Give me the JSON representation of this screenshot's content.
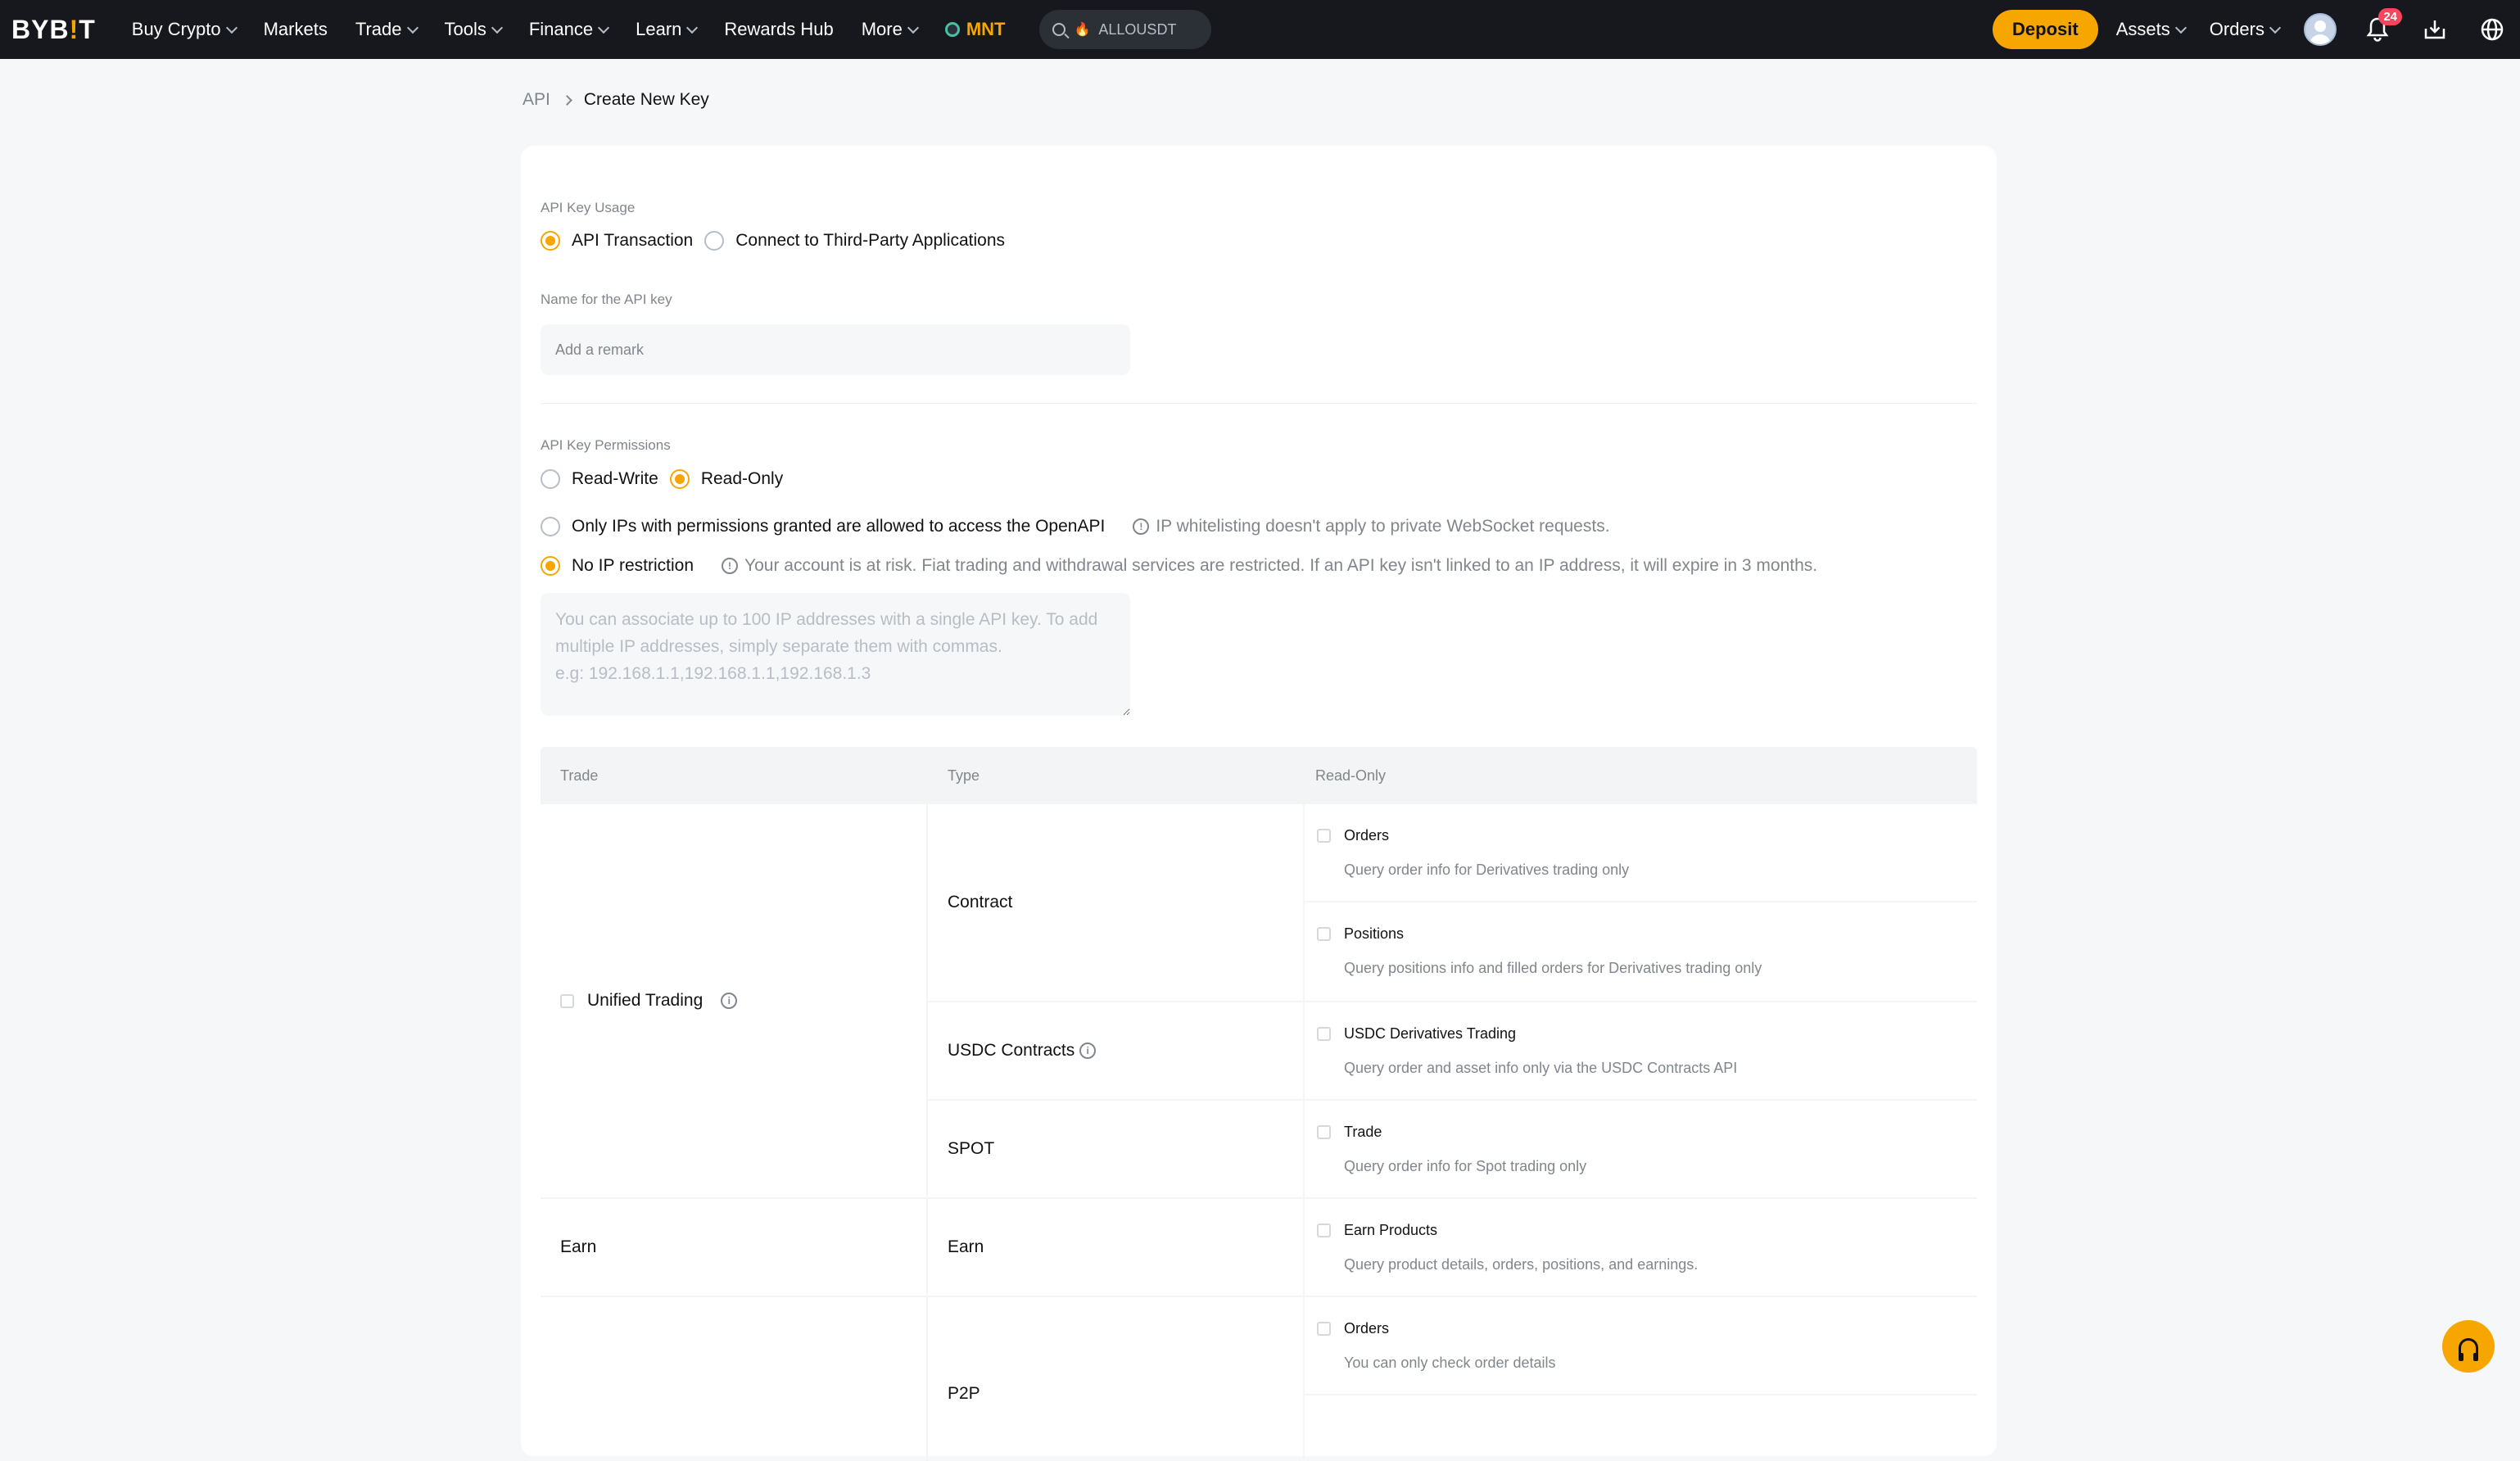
{
  "nav": {
    "logo": "BYBIT",
    "items": [
      {
        "label": "Buy Crypto",
        "dropdown": true
      },
      {
        "label": "Markets",
        "dropdown": false
      },
      {
        "label": "Trade",
        "dropdown": true
      },
      {
        "label": "Tools",
        "dropdown": true
      },
      {
        "label": "Finance",
        "dropdown": true
      },
      {
        "label": "Learn",
        "dropdown": true
      },
      {
        "label": "Rewards Hub",
        "dropdown": false
      },
      {
        "label": "More",
        "dropdown": true
      }
    ],
    "mnt": "MNT",
    "search_text": "ALLOUSDT",
    "deposit": "Deposit",
    "assets": "Assets",
    "orders": "Orders",
    "notification_count": "24",
    "colors": {
      "accent": "#f7a600",
      "nav_bg": "#17181e",
      "badge": "#f6465d"
    }
  },
  "breadcrumb": {
    "root": "API",
    "current": "Create New Key"
  },
  "form": {
    "usage_label": "API Key Usage",
    "usage_options": [
      {
        "label": "API Transaction",
        "selected": true
      },
      {
        "label": "Connect to Third-Party Applications",
        "selected": false
      }
    ],
    "name_label": "Name for the API key",
    "name_placeholder": "Add a remark",
    "permissions_label": "API Key Permissions",
    "permission_options": [
      {
        "label": "Read-Write",
        "selected": false
      },
      {
        "label": "Read-Only",
        "selected": true
      }
    ],
    "ip_option_restricted": "Only IPs with permissions granted are allowed to access the OpenAPI",
    "ip_note_restricted": "IP whitelisting doesn't apply to private WebSocket requests.",
    "ip_option_none": "No IP restriction",
    "ip_note_none": "Your account is at risk. Fiat trading and withdrawal services are restricted. If an API key isn't linked to an IP address, it will expire in 3 months.",
    "ip_placeholder": "You can associate up to 100 IP addresses with a single API key. To add multiple IP addresses, simply separate them with commas.\ne.g: 192.168.1.1,192.168.1.1,192.168.1.3"
  },
  "table": {
    "headers": {
      "trade": "Trade",
      "type": "Type",
      "perm": "Read-Only"
    },
    "trade_unified": "Unified Trading",
    "trade_earn": "Earn",
    "type_contract": "Contract",
    "type_usdc": "USDC Contracts",
    "type_spot": "SPOT",
    "type_earn": "Earn",
    "type_p2p": "P2P",
    "perms": [
      {
        "title": "Orders",
        "desc": "Query order info for Derivatives trading only"
      },
      {
        "title": "Positions",
        "desc": "Query positions info and filled orders for Derivatives trading only"
      },
      {
        "title": "USDC Derivatives Trading",
        "desc": "Query order and asset info only via the USDC Contracts API"
      },
      {
        "title": "Trade",
        "desc": "Query order info for Spot trading only"
      },
      {
        "title": "Earn Products",
        "desc": "Query product details, orders, positions, and earnings."
      },
      {
        "title": "Orders",
        "desc": "You can only check order details"
      }
    ]
  }
}
